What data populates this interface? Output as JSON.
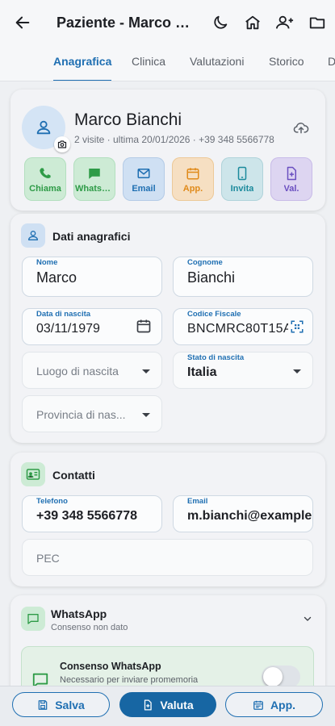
{
  "header": {
    "title": "Paziente - Marco Bianchi"
  },
  "tabs": [
    {
      "label": "Anagrafica"
    },
    {
      "label": "Clinica"
    },
    {
      "label": "Valutazioni"
    },
    {
      "label": "Storico"
    },
    {
      "label": "D"
    }
  ],
  "patient": {
    "name": "Marco Bianchi",
    "subtitle": "2 visite · ultima 20/01/2026 · +39 348 5566778"
  },
  "quick_actions": [
    {
      "label": "Chiama",
      "icon": "phone-icon",
      "color": "#2e9b47"
    },
    {
      "label": "WhatsApp",
      "icon": "whatsapp-icon",
      "color": "#2e9b47"
    },
    {
      "label": "Email",
      "icon": "mail-icon",
      "color": "#1f6fb2"
    },
    {
      "label": "App.",
      "icon": "calendar-icon",
      "color": "#e08a1a"
    },
    {
      "label": "Invita",
      "icon": "smartphone-icon",
      "color": "#1b8a9c"
    },
    {
      "label": "Val.",
      "icon": "document-add-icon",
      "color": "#6a4fc0"
    }
  ],
  "anagrafica": {
    "title": "Dati anagrafici",
    "nome": {
      "label": "Nome",
      "value": "Marco"
    },
    "cognome": {
      "label": "Cognome",
      "value": "Bianchi"
    },
    "data_nascita": {
      "label": "Data di nascita",
      "value": "03/11/1979"
    },
    "codice_fiscale": {
      "label": "Codice Fiscale",
      "value": "BNCMRC80T15A"
    },
    "luogo_nascita": {
      "placeholder": "Luogo di nascita"
    },
    "stato_nascita": {
      "label": "Stato di nascita",
      "value": "Italia"
    },
    "provincia_nascita": {
      "placeholder": "Provincia di nas..."
    }
  },
  "contatti": {
    "title": "Contatti",
    "telefono": {
      "label": "Telefono",
      "value": "+39 348 5566778"
    },
    "email": {
      "label": "Email",
      "value": "m.bianchi@example"
    },
    "pec": {
      "placeholder": "PEC"
    }
  },
  "whatsapp": {
    "title": "WhatsApp",
    "subtitle": "Consenso non dato",
    "consent_title": "Consenso WhatsApp",
    "consent_subtitle": "Necessario per inviare promemoria",
    "consent_enabled": false
  },
  "bottom_bar": {
    "save": "Salva",
    "evaluate": "Valuta",
    "appointment": "App."
  },
  "colors": {
    "primary": "#1f6fb2",
    "whatsapp_green": "#2e9b47",
    "primary_dark": "#1766a3"
  }
}
